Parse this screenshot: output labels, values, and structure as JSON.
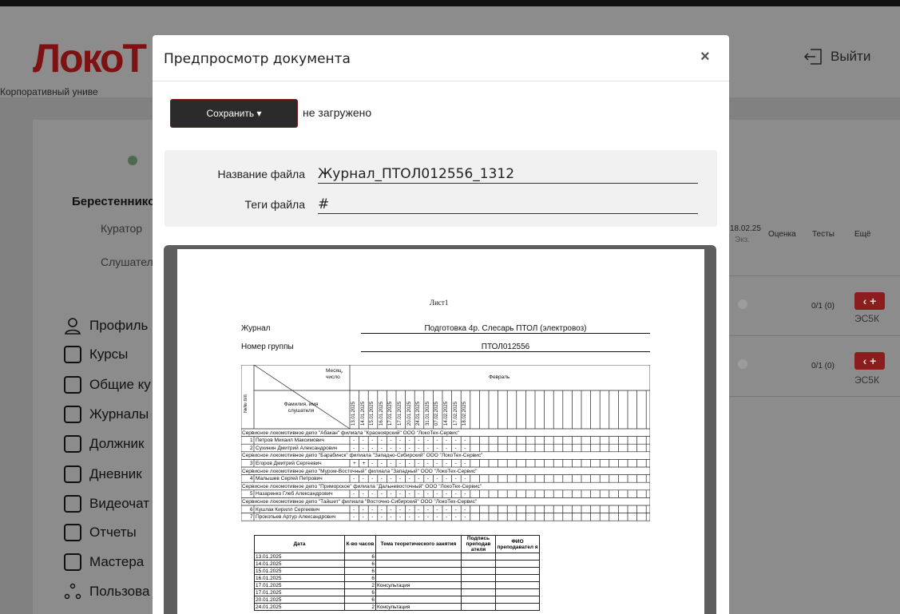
{
  "app": {
    "logo": "ЛокоТ",
    "subtitle": "Корпоративный униве",
    "logout": "Выйти"
  },
  "profile": {
    "name": "Берестеннико",
    "curator_label": "Куратор",
    "listener_label": "Слушател"
  },
  "sidebar": {
    "items": [
      {
        "label": "Профиль",
        "icon": "user-icon"
      },
      {
        "label": "Курсы",
        "icon": "book-icon"
      },
      {
        "label": "Общие ку",
        "icon": "book-icon"
      },
      {
        "label": "Журналы",
        "icon": "book-icon"
      },
      {
        "label": "Должник",
        "icon": "book-icon"
      },
      {
        "label": "Дневник",
        "icon": "book-icon"
      },
      {
        "label": "Видеочат",
        "icon": "video-icon"
      },
      {
        "label": "Отчеты",
        "icon": "report-icon"
      },
      {
        "label": "Мастера",
        "icon": "report-icon"
      },
      {
        "label": "Пользова",
        "icon": "users-icon"
      }
    ]
  },
  "table": {
    "headers": {
      "date": "18.02.25",
      "exam": "Экз.",
      "grade": "Оценка",
      "tests": "Тесты",
      "more": "Ещё"
    },
    "rows": [
      {
        "tests": "0/1 (0)",
        "action": "ЭС5К"
      },
      {
        "tests": "0/1 (0)",
        "action": "ЭС5К"
      }
    ]
  },
  "modal": {
    "title": "Предпросмотр документа",
    "close": "×",
    "save_label": "Сохранить",
    "status": "не загружено",
    "filename_label": "Название файла",
    "filename_value": "Журнал_ПТОЛ012556_1312",
    "tags_label": "Теги файла",
    "tags_value": "#"
  },
  "document": {
    "sheet": "Лист1",
    "journal_label": "Журнал",
    "journal_value": "Подготовка 4р. Слесарь ПТОЛ (электровоз)",
    "group_label": "Номер группы",
    "group_value": "ПТОЛ012556",
    "num_col": "№№ п/п",
    "month_label": "Месяц, число",
    "name_label": "Фамилия, имя слушателя",
    "month": "Февраль",
    "dates": [
      "13.01.2025",
      "14.01.2025",
      "15.01.2025",
      "16.01.2025",
      "17.01.2025",
      "17.01.2025",
      "20.01.2025",
      "24.01.2025",
      "31.01.2025",
      "07.02.2025",
      "14.02.2025",
      "17.02.2025",
      "18.02.2025"
    ],
    "groups": [
      {
        "title": "Сервисное локомотивное депо \"Абакан\" филиала \"Красноярский\" ООО \"ЛокоТех-Сервис\"",
        "rows": [
          {
            "n": "1",
            "name": "Петров Михаил Максимович",
            "marks": "- - - - - - - - - - - - -"
          },
          {
            "n": "2",
            "name": "Сухинин Дмитрий Александрович",
            "marks": "- - - - - - - - - - - - -"
          }
        ]
      },
      {
        "title": "Сервисное локомотивное депо \"Барабинск\" филиала \"Западно-Сибирский\" ООО \"ЛокоТех-Сервис\"",
        "rows": [
          {
            "n": "3",
            "name": "Егоров Дмитрий Сергеевич",
            "marks": "+ + - - - - - - - - - - -"
          }
        ]
      },
      {
        "title": "Сервисное локомотивное депо \"Муром-Восточный\" филиала \"Западный\" ООО \"ЛокоТех-Сервис\"",
        "rows": [
          {
            "n": "4",
            "name": "Малышев Сергей Петрович",
            "marks": "- - - - - - - - - - - - -"
          }
        ]
      },
      {
        "title": "Сервисное локомотивное депо \"Приморское\" филиала \"Дальневосточный\" ООО \"ЛокоТех-Сервис\"",
        "rows": [
          {
            "n": "5",
            "name": "Назаренко Глеб Александрович",
            "marks": "- - - - - - - - - - - - -"
          }
        ]
      },
      {
        "title": "Сервисное локомотивное депо \"Тайшет\" филиала \"Восточно-Сибирский\" ООО \"ЛокоТех-Сервис\"",
        "rows": [
          {
            "n": "6",
            "name": "Кушлак Кирилл Сергеевич",
            "marks": "- - - - - - - - - - - - -"
          },
          {
            "n": "7",
            "name": "Прокопьев Артур Александрович",
            "marks": "- - - - - - - - - - - - -"
          }
        ]
      }
    ],
    "lessons_headers": {
      "date": "Дата",
      "hours": "К-во часов",
      "topic": "Тема теоретического занятия",
      "sign": "Подпись преподав ателя",
      "fio": "ФИО преподавател я"
    },
    "lessons": [
      {
        "date": "13.01.2025",
        "hours": "6",
        "topic": ""
      },
      {
        "date": "14.01.2025",
        "hours": "6",
        "topic": ""
      },
      {
        "date": "15.01.2025",
        "hours": "6",
        "topic": ""
      },
      {
        "date": "16.01.2025",
        "hours": "6",
        "topic": ""
      },
      {
        "date": "17.01.2025",
        "hours": "2",
        "topic": "Консультация"
      },
      {
        "date": "17.01.2025",
        "hours": "6",
        "topic": ""
      },
      {
        "date": "20.01.2025",
        "hours": "6",
        "topic": ""
      },
      {
        "date": "24.01.2025",
        "hours": "2",
        "topic": "Консультация"
      }
    ]
  }
}
